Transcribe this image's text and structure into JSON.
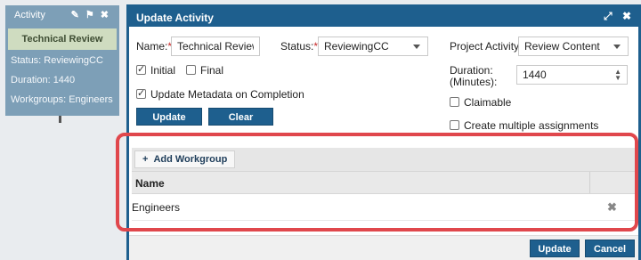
{
  "card": {
    "title": "Activity",
    "icons": [
      "edit-icon",
      "flag-icon",
      "close-icon"
    ],
    "icon_glyphs": [
      "✎",
      "⚑",
      "✖"
    ],
    "name": "Technical Review",
    "status": "Status: ReviewingCC",
    "duration": "Duration: 1440",
    "workgroups": "Workgroups: Engineers"
  },
  "dialog": {
    "title": "Update Activity",
    "expand_glyph": "⤢",
    "close_glyph": "✖",
    "name_label": "Name:",
    "name_value": "Technical Review",
    "status_label": "Status:",
    "status_value": "ReviewingCC",
    "project_activity_label": "Project Activity:",
    "project_activity_value": "Review Content",
    "initial_label": "Initial",
    "final_label": "Final",
    "update_metadata_label": "Update Metadata on Completion",
    "duration_label_1": "Duration:",
    "duration_label_2": "(Minutes):",
    "duration_value": "1440",
    "claimable_label": "Claimable",
    "multiple_assignments_label": "Create multiple assignments",
    "update_button": "Update",
    "clear_button": "Clear",
    "required_mark": "*",
    "checks": {
      "initial": true,
      "final": false,
      "update_metadata": true,
      "claimable": false,
      "multiple": false
    }
  },
  "workgroups": {
    "add_button": "Add Workgroup",
    "add_glyph": "+",
    "column_name": "Name",
    "rows": [
      {
        "name": "Engineers",
        "delete_glyph": "✖"
      }
    ]
  },
  "footer": {
    "update_button": "Update",
    "cancel_button": "Cancel"
  },
  "colors": {
    "header_blue": "#1e5f8e",
    "card_blue": "#7d9fb7",
    "card_name_green": "#cfdcc0",
    "highlight_red": "#e0474c"
  }
}
